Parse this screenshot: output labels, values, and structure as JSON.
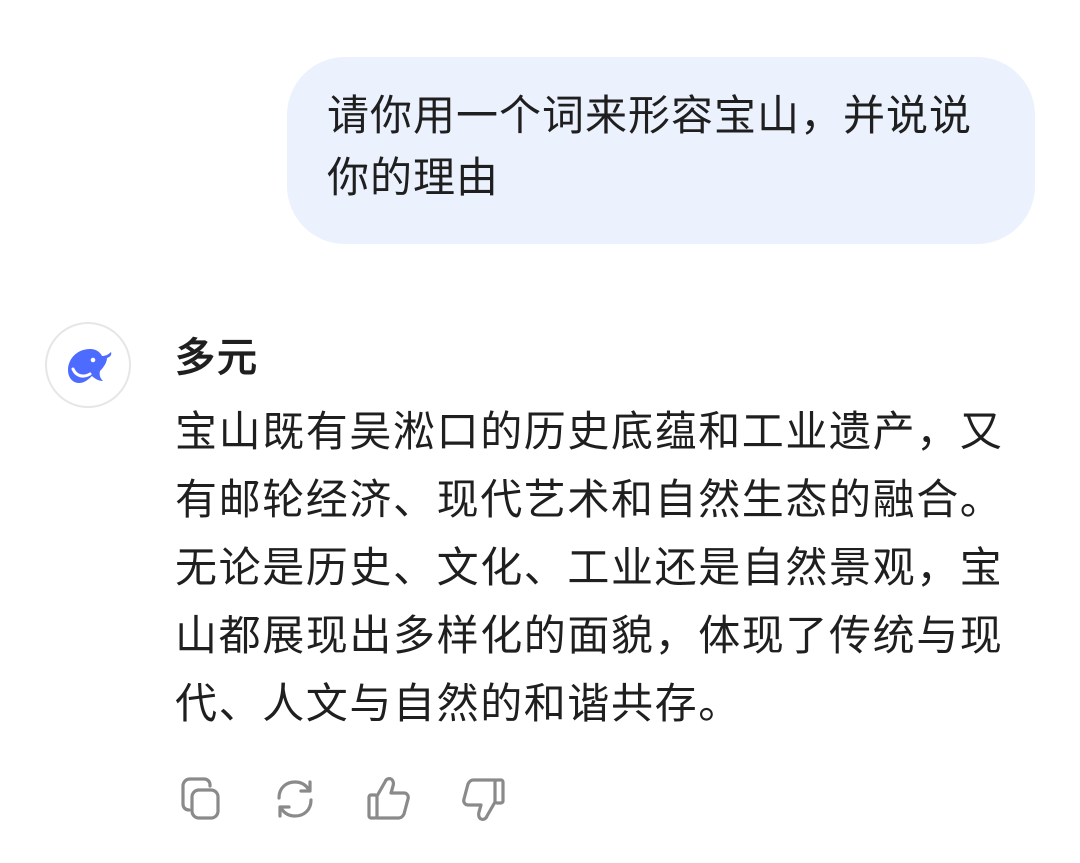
{
  "user_message": {
    "text": "请你用一个词来形容宝山，并说说你的理由"
  },
  "assistant": {
    "name": "多元",
    "avatar_icon": "whale-logo-icon",
    "brand_color": "#4d6bfe",
    "message": "宝山既有吴淞口的历史底蕴和工业遗产，又有邮轮经济、现代艺术和自然生态的融合。无论是历史、文化、工业还是自然景观，宝山都展现出多样化的面貌，体现了传统与现代、人文与自然的和谐共存。"
  },
  "actions": [
    {
      "icon": "copy-icon"
    },
    {
      "icon": "regenerate-icon"
    },
    {
      "icon": "thumbs-up-icon"
    },
    {
      "icon": "thumbs-down-icon"
    }
  ],
  "colors": {
    "bubble_bg": "#ebf1fd",
    "text": "#1f1f1f",
    "icon_gray": "#8a8a8a"
  }
}
